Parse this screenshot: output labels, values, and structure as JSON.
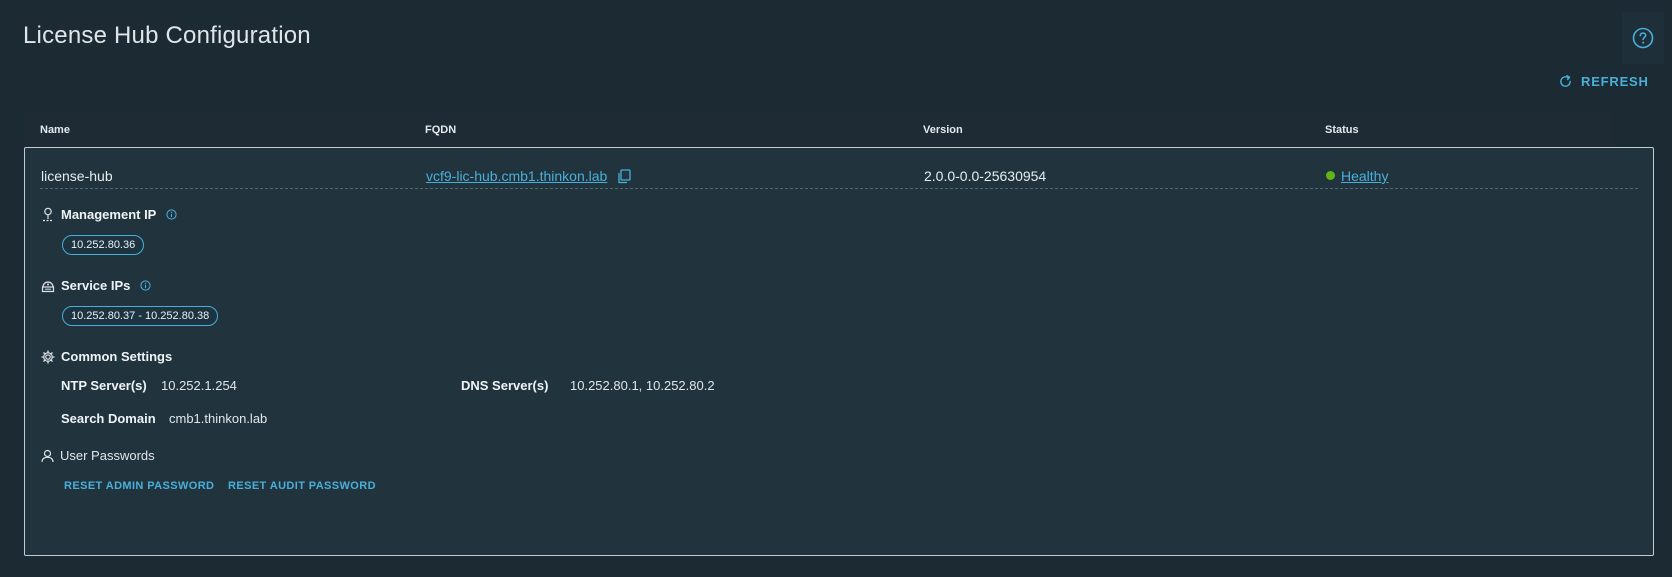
{
  "page": {
    "title": "License Hub Configuration"
  },
  "toolbar": {
    "refresh_label": "REFRESH",
    "help_icon": "help-circle-icon"
  },
  "grid": {
    "columns": [
      "Name",
      "FQDN",
      "Version",
      "Status"
    ],
    "row": {
      "name": "license-hub",
      "fqdn": "vcf9-lic-hub.cmb1.thinkon.lab",
      "version": "2.0.0-0.0-25630954",
      "status": "Healthy",
      "status_color": "#60b515"
    }
  },
  "details": {
    "management_ip": {
      "title": "Management IP",
      "value": "10.252.80.36"
    },
    "service_ips": {
      "title": "Service IPs",
      "value": "10.252.80.37 - 10.252.80.38"
    },
    "common_settings": {
      "title": "Common Settings",
      "ntp_label": "NTP Server(s)",
      "ntp_value": "10.252.1.254",
      "dns_label": "DNS Server(s)",
      "dns_value": "10.252.80.1, 10.252.80.2",
      "search_domain_label": "Search Domain",
      "search_domain_value": "cmb1.thinkon.lab"
    },
    "user_passwords": {
      "title": "User Passwords",
      "reset_admin_label": "RESET ADMIN PASSWORD",
      "reset_audit_label": "RESET AUDIT PASSWORD"
    }
  },
  "colors": {
    "accent": "#49afd9",
    "background": "#1b2a33",
    "healthy": "#60b515"
  }
}
